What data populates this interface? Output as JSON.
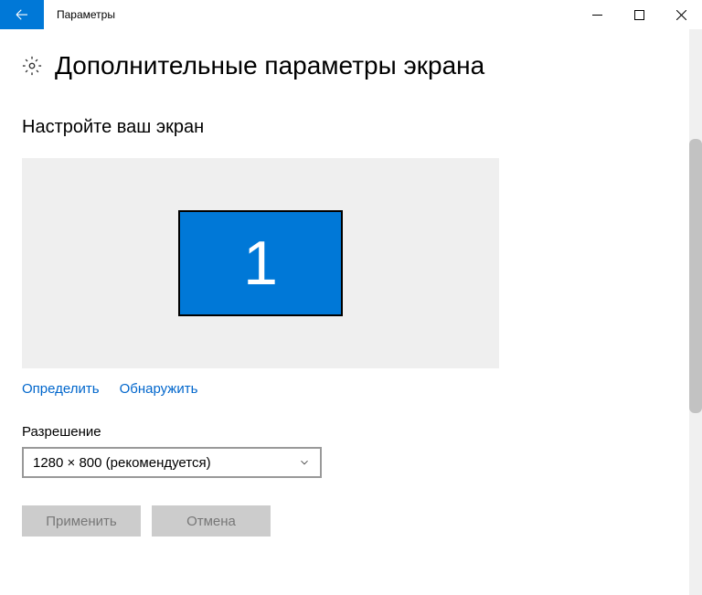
{
  "window": {
    "title": "Параметры"
  },
  "page": {
    "title": "Дополнительные параметры экрана"
  },
  "section": {
    "title": "Настройте ваш экран"
  },
  "display": {
    "monitor_label": "1"
  },
  "links": {
    "identify": "Определить",
    "detect": "Обнаружить"
  },
  "resolution": {
    "label": "Разрешение",
    "selected": "1280 × 800 (рекомендуется)"
  },
  "buttons": {
    "apply": "Применить",
    "cancel": "Отмена"
  }
}
